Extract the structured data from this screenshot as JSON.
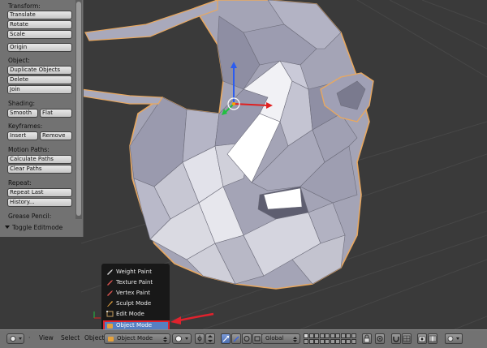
{
  "tool_shelf": {
    "transform": {
      "label": "Transform:",
      "buttons": [
        "Translate",
        "Rotate",
        "Scale"
      ]
    },
    "origin_button": "Origin",
    "object": {
      "label": "Object:",
      "buttons": [
        "Duplicate Objects",
        "Delete",
        "Join"
      ]
    },
    "shading": {
      "label": "Shading:",
      "smooth": "Smooth",
      "flat": "Flat"
    },
    "keyframes": {
      "label": "Keyframes:",
      "insert": "Insert",
      "remove": "Remove"
    },
    "motion_paths": {
      "label": "Motion Paths:",
      "buttons": [
        "Calculate Paths",
        "Clear Paths"
      ]
    },
    "repeat": {
      "label": "Repeat:",
      "buttons": [
        "Repeat Last",
        "History..."
      ]
    },
    "grease_pencil": {
      "label": "Grease Pencil:"
    },
    "toggle_editmode": "Toggle Editmode"
  },
  "mode_menu": {
    "items": [
      {
        "label": "Weight Paint",
        "icon": "weight-paint-icon",
        "color": "#d6d6d6"
      },
      {
        "label": "Texture Paint",
        "icon": "texture-paint-icon",
        "color": "#d9534f"
      },
      {
        "label": "Vertex Paint",
        "icon": "vertex-paint-icon",
        "color": "#d9534f"
      },
      {
        "label": "Sculpt Mode",
        "icon": "sculpt-mode-icon",
        "color": "#e6a23c"
      },
      {
        "label": "Edit Mode",
        "icon": "edit-mode-icon",
        "color": "#c8a060"
      },
      {
        "label": "Object Mode",
        "icon": "object-mode-icon",
        "color": "#e6a23c",
        "selected": true
      }
    ]
  },
  "header": {
    "menus": [
      "View",
      "Select",
      "Object"
    ],
    "mode_select": "Object Mode",
    "orientation": "Global"
  },
  "colors": {
    "viewport_bg": "#3a3a3a",
    "panel_bg": "#727272",
    "selection_highlight": "#5680c2",
    "annotation_red": "#e0222d",
    "mesh_outline": "#e8a860"
  }
}
